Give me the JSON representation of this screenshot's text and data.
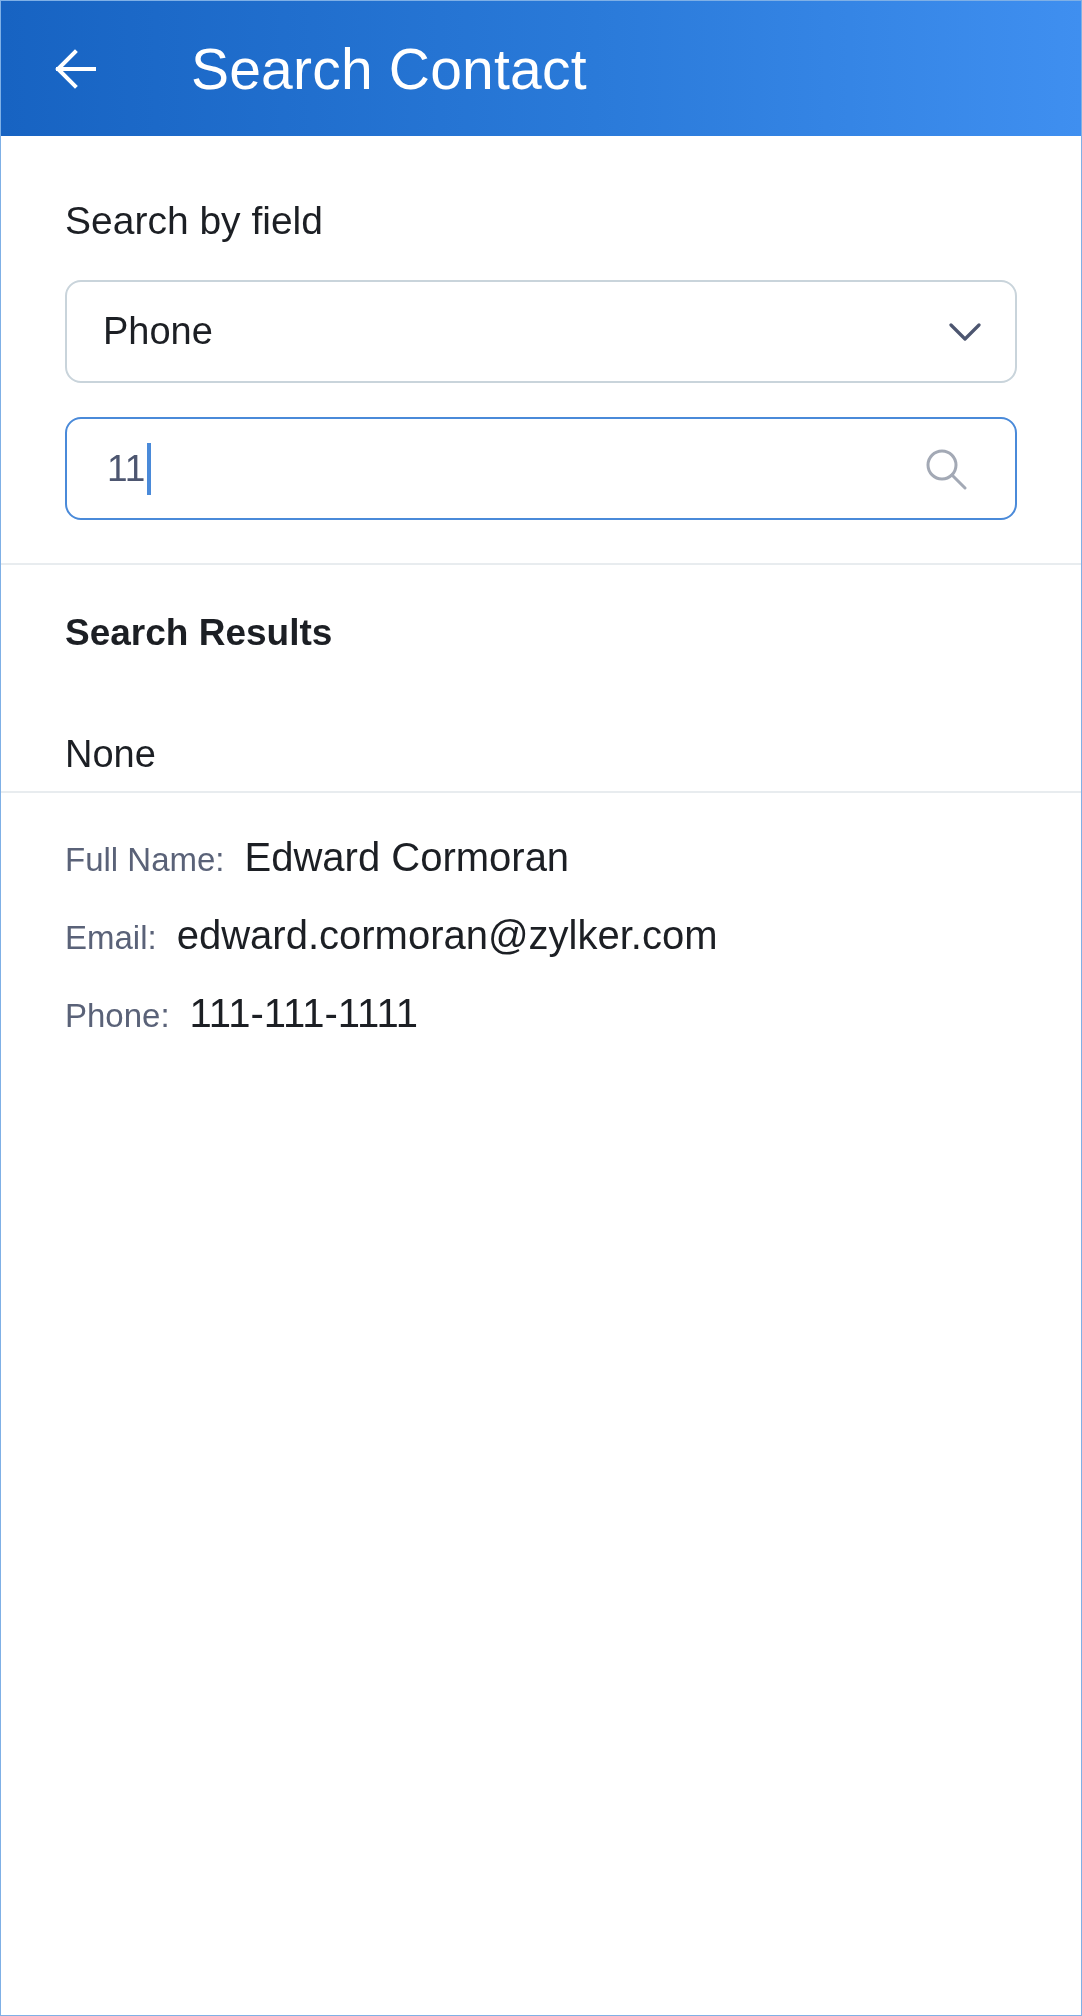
{
  "header": {
    "title": "Search Contact"
  },
  "search_by": {
    "label": "Search by field",
    "dropdown_value": "Phone"
  },
  "search_field": {
    "value": "11",
    "focused": true
  },
  "results": {
    "title": "Search Results",
    "status": "None",
    "fields": [
      {
        "label": "Full Name:",
        "value": "Edward Cormoran"
      },
      {
        "label": "Email:",
        "value": "edward.cormoran@zylker.com"
      },
      {
        "label": "Phone:",
        "value": "111-111-1111"
      }
    ]
  }
}
